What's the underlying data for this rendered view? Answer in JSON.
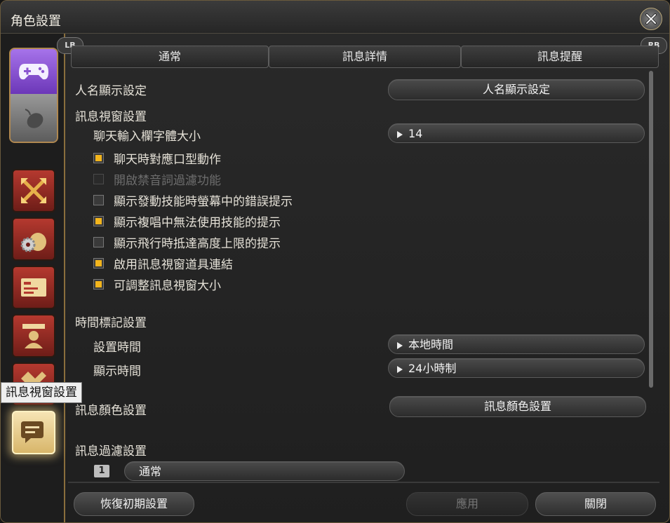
{
  "window": {
    "title": "角色設置"
  },
  "controller_hints": {
    "left": "LB",
    "right": "RB"
  },
  "tabs": [
    {
      "label": "通常",
      "active": true
    },
    {
      "label": "訊息詳情",
      "active": false
    },
    {
      "label": "訊息提醒",
      "active": false
    }
  ],
  "sidebar": {
    "mode_switch": {
      "gamepad_icon": "gamepad-icon",
      "mouse_icon": "mouse-icon",
      "selected": "gamepad"
    },
    "categories": [
      {
        "icon": "crossed-arrows-icon"
      },
      {
        "icon": "gear-bag-icon"
      },
      {
        "icon": "id-card-icon"
      },
      {
        "icon": "character-icon"
      },
      {
        "icon": "hud-pattern-icon"
      },
      {
        "icon": "chat-bubble-icon",
        "active": true
      }
    ],
    "tooltip": "訊息視窗設置"
  },
  "content": {
    "name_display": {
      "label": "人名顯示設定",
      "button": "人名顯示設定"
    },
    "log_window": {
      "heading": "訊息視窗設置",
      "font_size_label": "聊天輸入欄字體大小",
      "font_size_value": "14",
      "options": [
        {
          "label": "聊天時對應口型動作",
          "checked": true,
          "enabled": true
        },
        {
          "label": "開啟禁音詞過濾功能",
          "checked": false,
          "enabled": false
        },
        {
          "label": "顯示發動技能時螢幕中的錯誤提示",
          "checked": false,
          "enabled": true
        },
        {
          "label": "顯示複唱中無法使用技能的提示",
          "checked": true,
          "enabled": true
        },
        {
          "label": "顯示飛行時抵達高度上限的提示",
          "checked": false,
          "enabled": true
        },
        {
          "label": "啟用訊息視窗道具連結",
          "checked": true,
          "enabled": true
        },
        {
          "label": "可調整訊息視窗大小",
          "checked": true,
          "enabled": true
        }
      ]
    },
    "timestamp": {
      "heading": "時間標記設置",
      "set_time_label": "設置時間",
      "set_time_value": "本地時間",
      "display_time_label": "顯示時間",
      "display_time_value": "24小時制"
    },
    "log_color": {
      "label": "訊息顏色設置",
      "button": "訊息顏色設置"
    },
    "log_filter": {
      "heading": "訊息過濾設置",
      "index": "1",
      "value": "通常"
    }
  },
  "footer": {
    "reset": "恢復初期設置",
    "apply": "應用",
    "close": "關閉"
  },
  "colors": {
    "accent_checkbox": "#f3b51c",
    "frame_gold": "#8a6e3c"
  }
}
